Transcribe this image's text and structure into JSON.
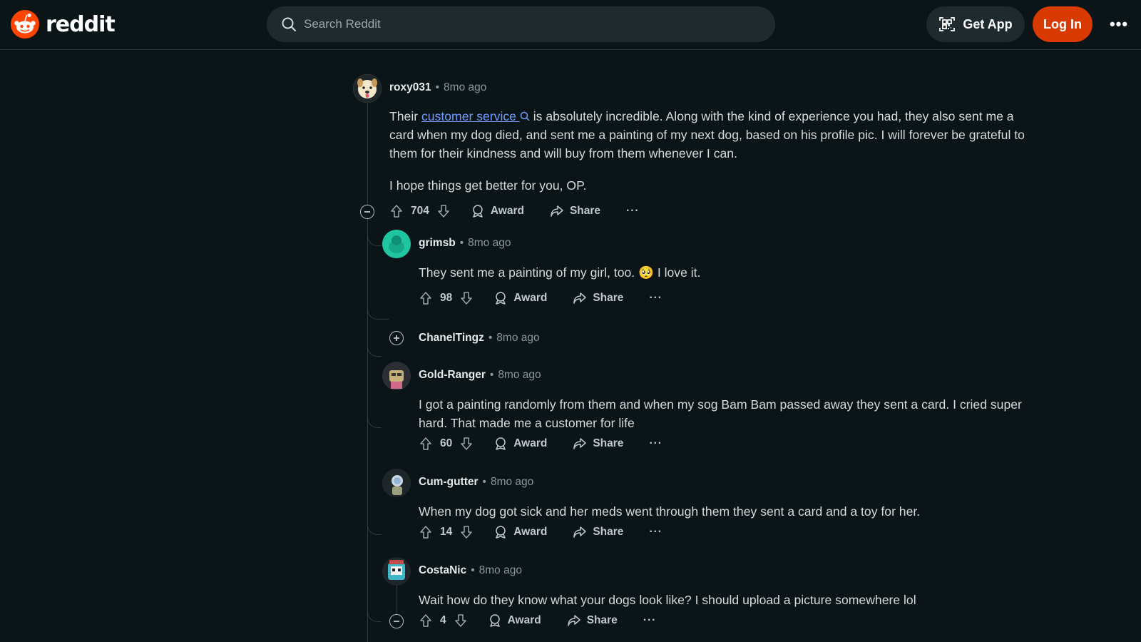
{
  "header": {
    "logo_text": "reddit",
    "search_placeholder": "Search Reddit",
    "get_app_label": "Get App",
    "login_label": "Log In",
    "more_label": "•••",
    "brand_color": "#d93a00"
  },
  "actions": {
    "award_label": "Award",
    "share_label": "Share",
    "more_label": "···"
  },
  "comments": [
    {
      "user": "roxy031",
      "time": "8mo ago",
      "body_prefix": "Their ",
      "body_link": "customer service",
      "body_rest": " is absolutely incredible. Along with the kind of experience you had, they also sent me a card when my dog died, and sent me a painting of my next dog, based on his profile pic. I will forever be grateful to them for their kindness and will buy from them whenever I can.",
      "body_p2": "I hope things get better for you, OP.",
      "score": "704"
    },
    {
      "user": "grimsb",
      "time": "8mo ago",
      "body": "They sent me a painting of my girl, too. 🥺 I love it.",
      "score": "98"
    },
    {
      "user": "ChanelTingz",
      "time": "8mo ago",
      "collapsed": true
    },
    {
      "user": "Gold-Ranger",
      "time": "8mo ago",
      "body": "I got a painting randomly from them and when my sog Bam Bam passed away they sent a card. I cried super hard. That made me a customer for life",
      "score": "60"
    },
    {
      "user": "Cum-gutter",
      "time": "8mo ago",
      "body": "When my dog got sick and her meds went through them they sent a card and a toy for her.",
      "score": "14"
    },
    {
      "user": "CostaNic",
      "time": "8mo ago",
      "body": "Wait how do they know what your dogs look like? I should upload a picture somewhere lol",
      "score": "4"
    }
  ]
}
